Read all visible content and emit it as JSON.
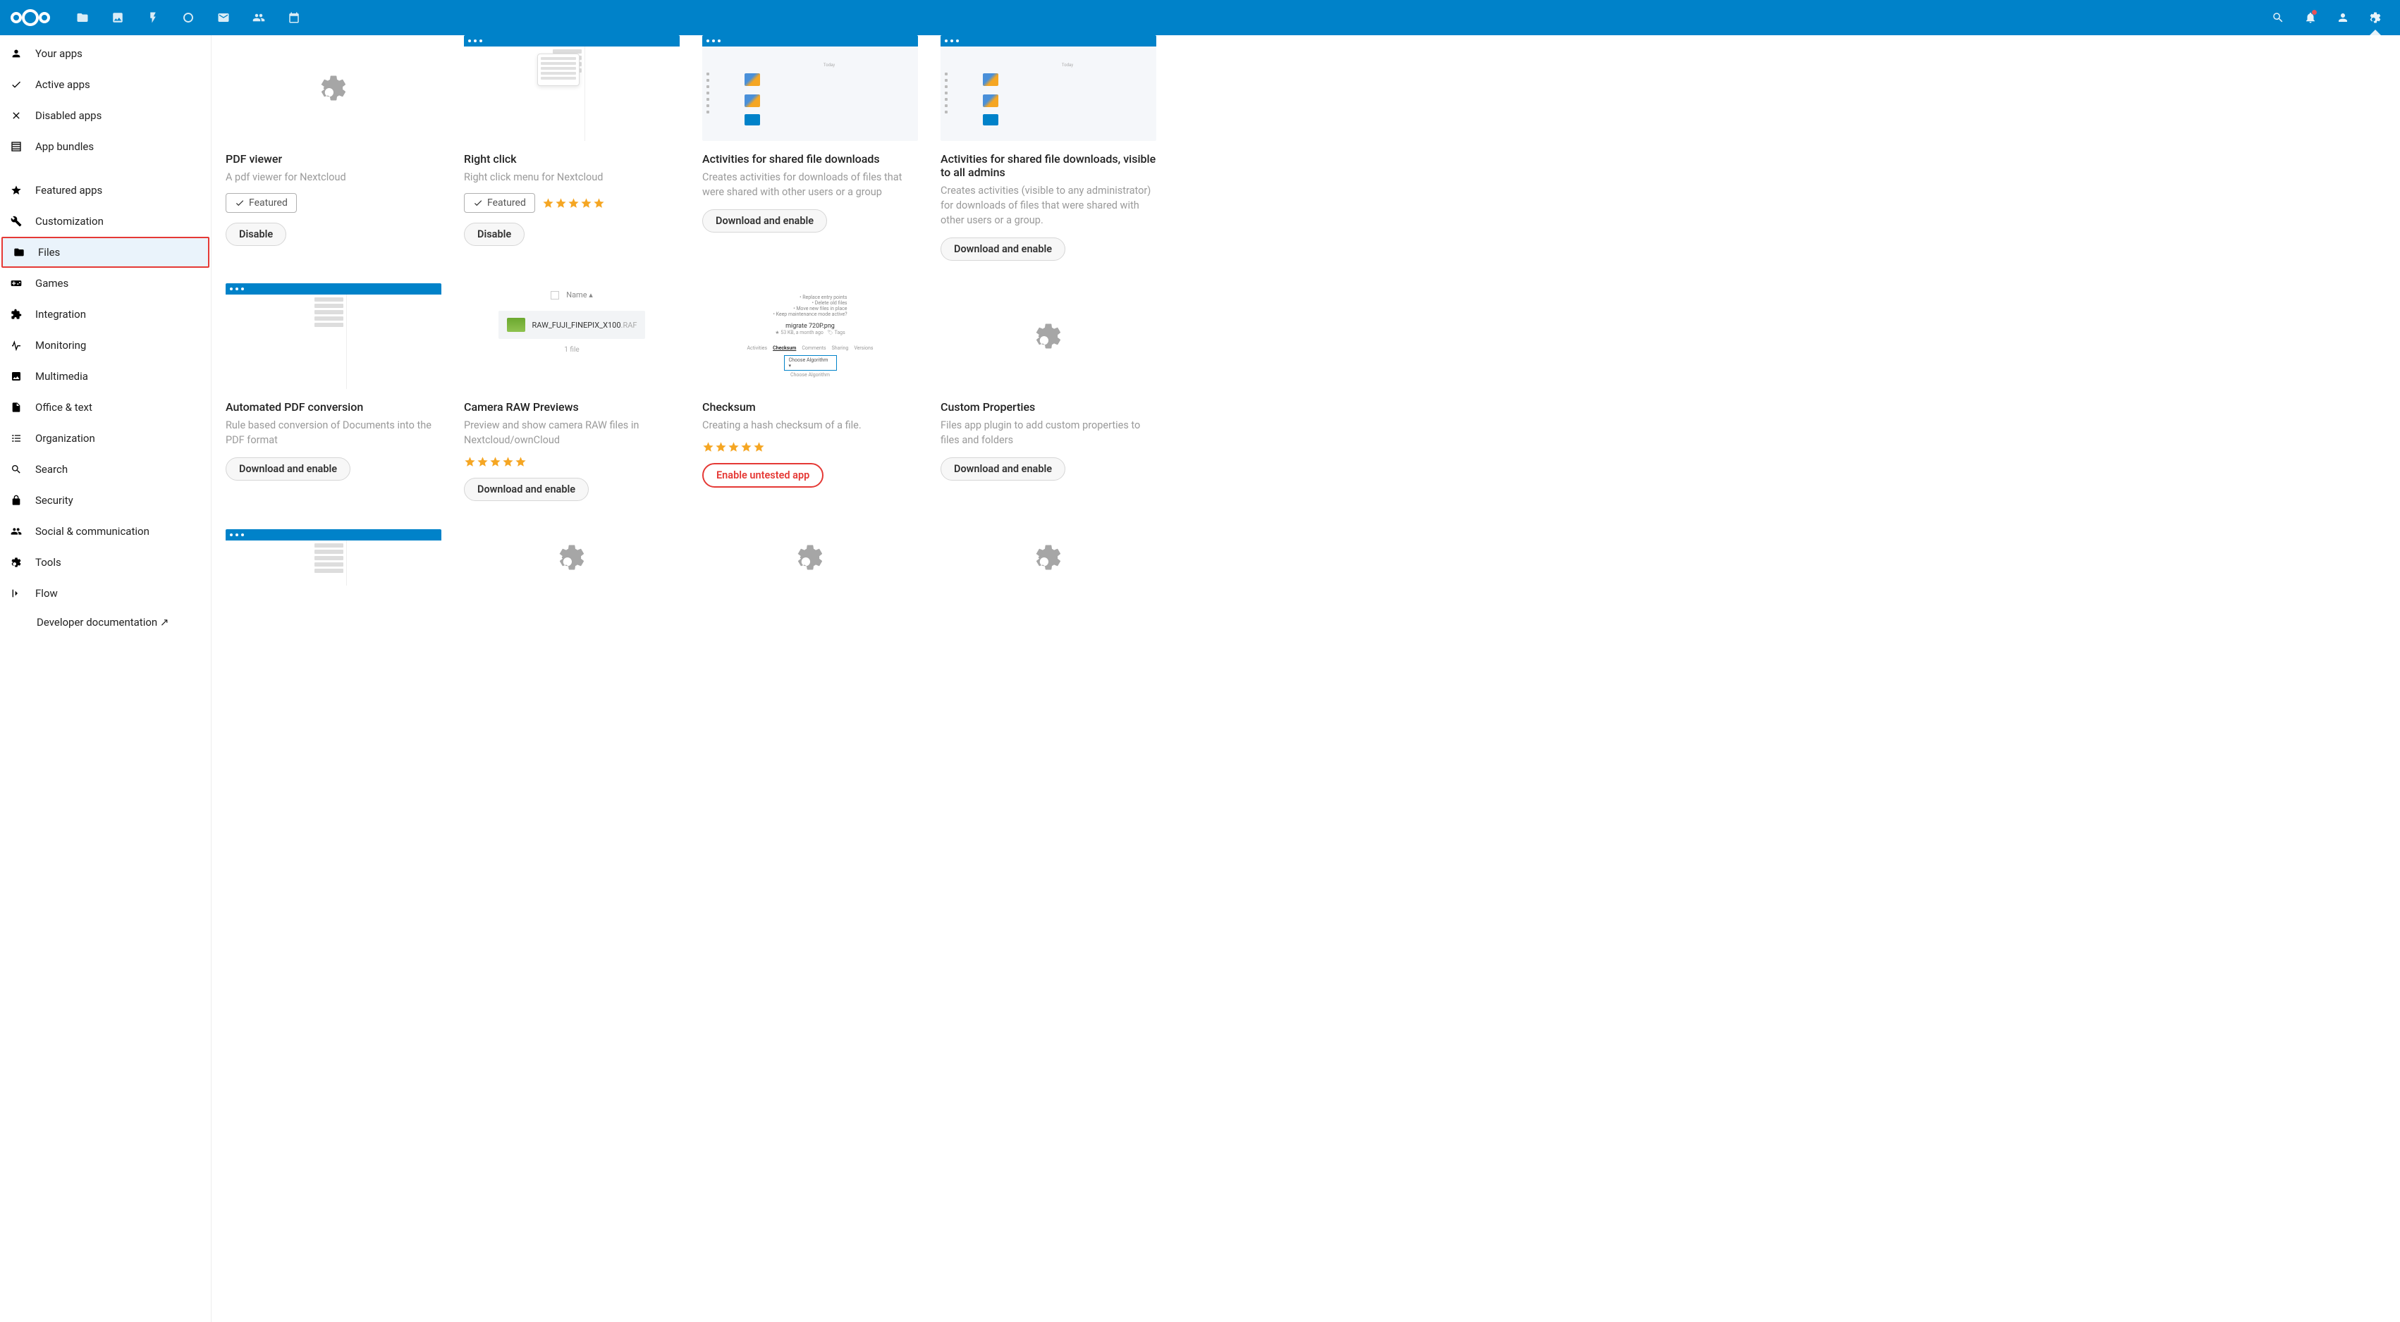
{
  "topnav": [
    {
      "name": "files-icon"
    },
    {
      "name": "photos-icon"
    },
    {
      "name": "activity-icon"
    },
    {
      "name": "talk-icon"
    },
    {
      "name": "mail-icon"
    },
    {
      "name": "contacts-icon"
    },
    {
      "name": "calendar-icon"
    }
  ],
  "sidebar": {
    "items": [
      {
        "icon": "user",
        "label": "Your apps"
      },
      {
        "icon": "check",
        "label": "Active apps"
      },
      {
        "icon": "close",
        "label": "Disabled apps"
      },
      {
        "icon": "bundle",
        "label": "App bundles"
      },
      {
        "gap": true
      },
      {
        "icon": "star",
        "label": "Featured apps"
      },
      {
        "icon": "wrench",
        "label": "Customization"
      },
      {
        "icon": "folder",
        "label": "Files",
        "active": true
      },
      {
        "icon": "games",
        "label": "Games"
      },
      {
        "icon": "integration",
        "label": "Integration"
      },
      {
        "icon": "monitor",
        "label": "Monitoring"
      },
      {
        "icon": "multimedia",
        "label": "Multimedia"
      },
      {
        "icon": "office",
        "label": "Office & text"
      },
      {
        "icon": "organization",
        "label": "Organization"
      },
      {
        "icon": "search",
        "label": "Search"
      },
      {
        "icon": "security",
        "label": "Security"
      },
      {
        "icon": "social",
        "label": "Social & communication"
      },
      {
        "icon": "tools",
        "label": "Tools"
      },
      {
        "icon": "flow",
        "label": "Flow"
      }
    ],
    "developer": "Developer documentation ↗"
  },
  "apps": [
    {
      "title": "PDF viewer",
      "desc": "A pdf viewer for Nextcloud",
      "featured": true,
      "rating": 0,
      "action": "Disable",
      "thumb": "gear"
    },
    {
      "title": "Right click",
      "desc": "Right click menu for Nextcloud",
      "featured": true,
      "rating": 4.5,
      "action": "Disable",
      "thumb": "menu"
    },
    {
      "title": "Activities for shared file downloads",
      "desc": "Creates activities for downloads of files that were shared with other users or a group",
      "featured": false,
      "rating": 0,
      "action": "Download and enable",
      "thumb": "activity"
    },
    {
      "title": "Activities for shared file downloads, visible to all admins",
      "desc": "Creates activities (visible to any administrator) for downloads of files that were shared with other users or a group.",
      "featured": false,
      "rating": 0,
      "action": "Download and enable",
      "thumb": "activity"
    },
    {
      "title": "Automated PDF conversion",
      "desc": "Rule based conversion of Documents into the PDF format",
      "featured": false,
      "rating": 0,
      "action": "Download and enable",
      "thumb": "pdfconv"
    },
    {
      "title": "Camera RAW Previews",
      "desc": "Preview and show camera RAW files in Nextcloud/ownCloud",
      "featured": false,
      "rating": 5,
      "action": "Download and enable",
      "thumb": "raw",
      "raw_name": "RAW_FUJI_FINEPIX_X100",
      "raw_ext": ".RAF",
      "raw_header": "Name",
      "raw_footer": "1 file"
    },
    {
      "title": "Checksum",
      "desc": "Creating a hash checksum of a file.",
      "featured": false,
      "rating": 4.5,
      "action": "Enable untested app",
      "danger": true,
      "thumb": "checksum",
      "cs_file": "migrate 720P.png",
      "cs_meta": "★ 53 KB, a month ago",
      "cs_tags": "Tags",
      "cs_tabs": [
        "Activities",
        "Checksum",
        "Comments",
        "Sharing",
        "Versions"
      ],
      "cs_dropdown": "Choose Algorithm",
      "cs_bullets": [
        "Replace entry points",
        "Delete old files",
        "Move new files in place",
        "Keep maintenance mode active?"
      ]
    },
    {
      "title": "Custom Properties",
      "desc": "Files app plugin to add custom properties to files and folders",
      "featured": false,
      "rating": 0,
      "action": "Download and enable",
      "thumb": "gear"
    }
  ],
  "row3_thumbs": [
    "pdfconv",
    "gear",
    "gear",
    "gear"
  ],
  "labels": {
    "featured": "Featured"
  }
}
